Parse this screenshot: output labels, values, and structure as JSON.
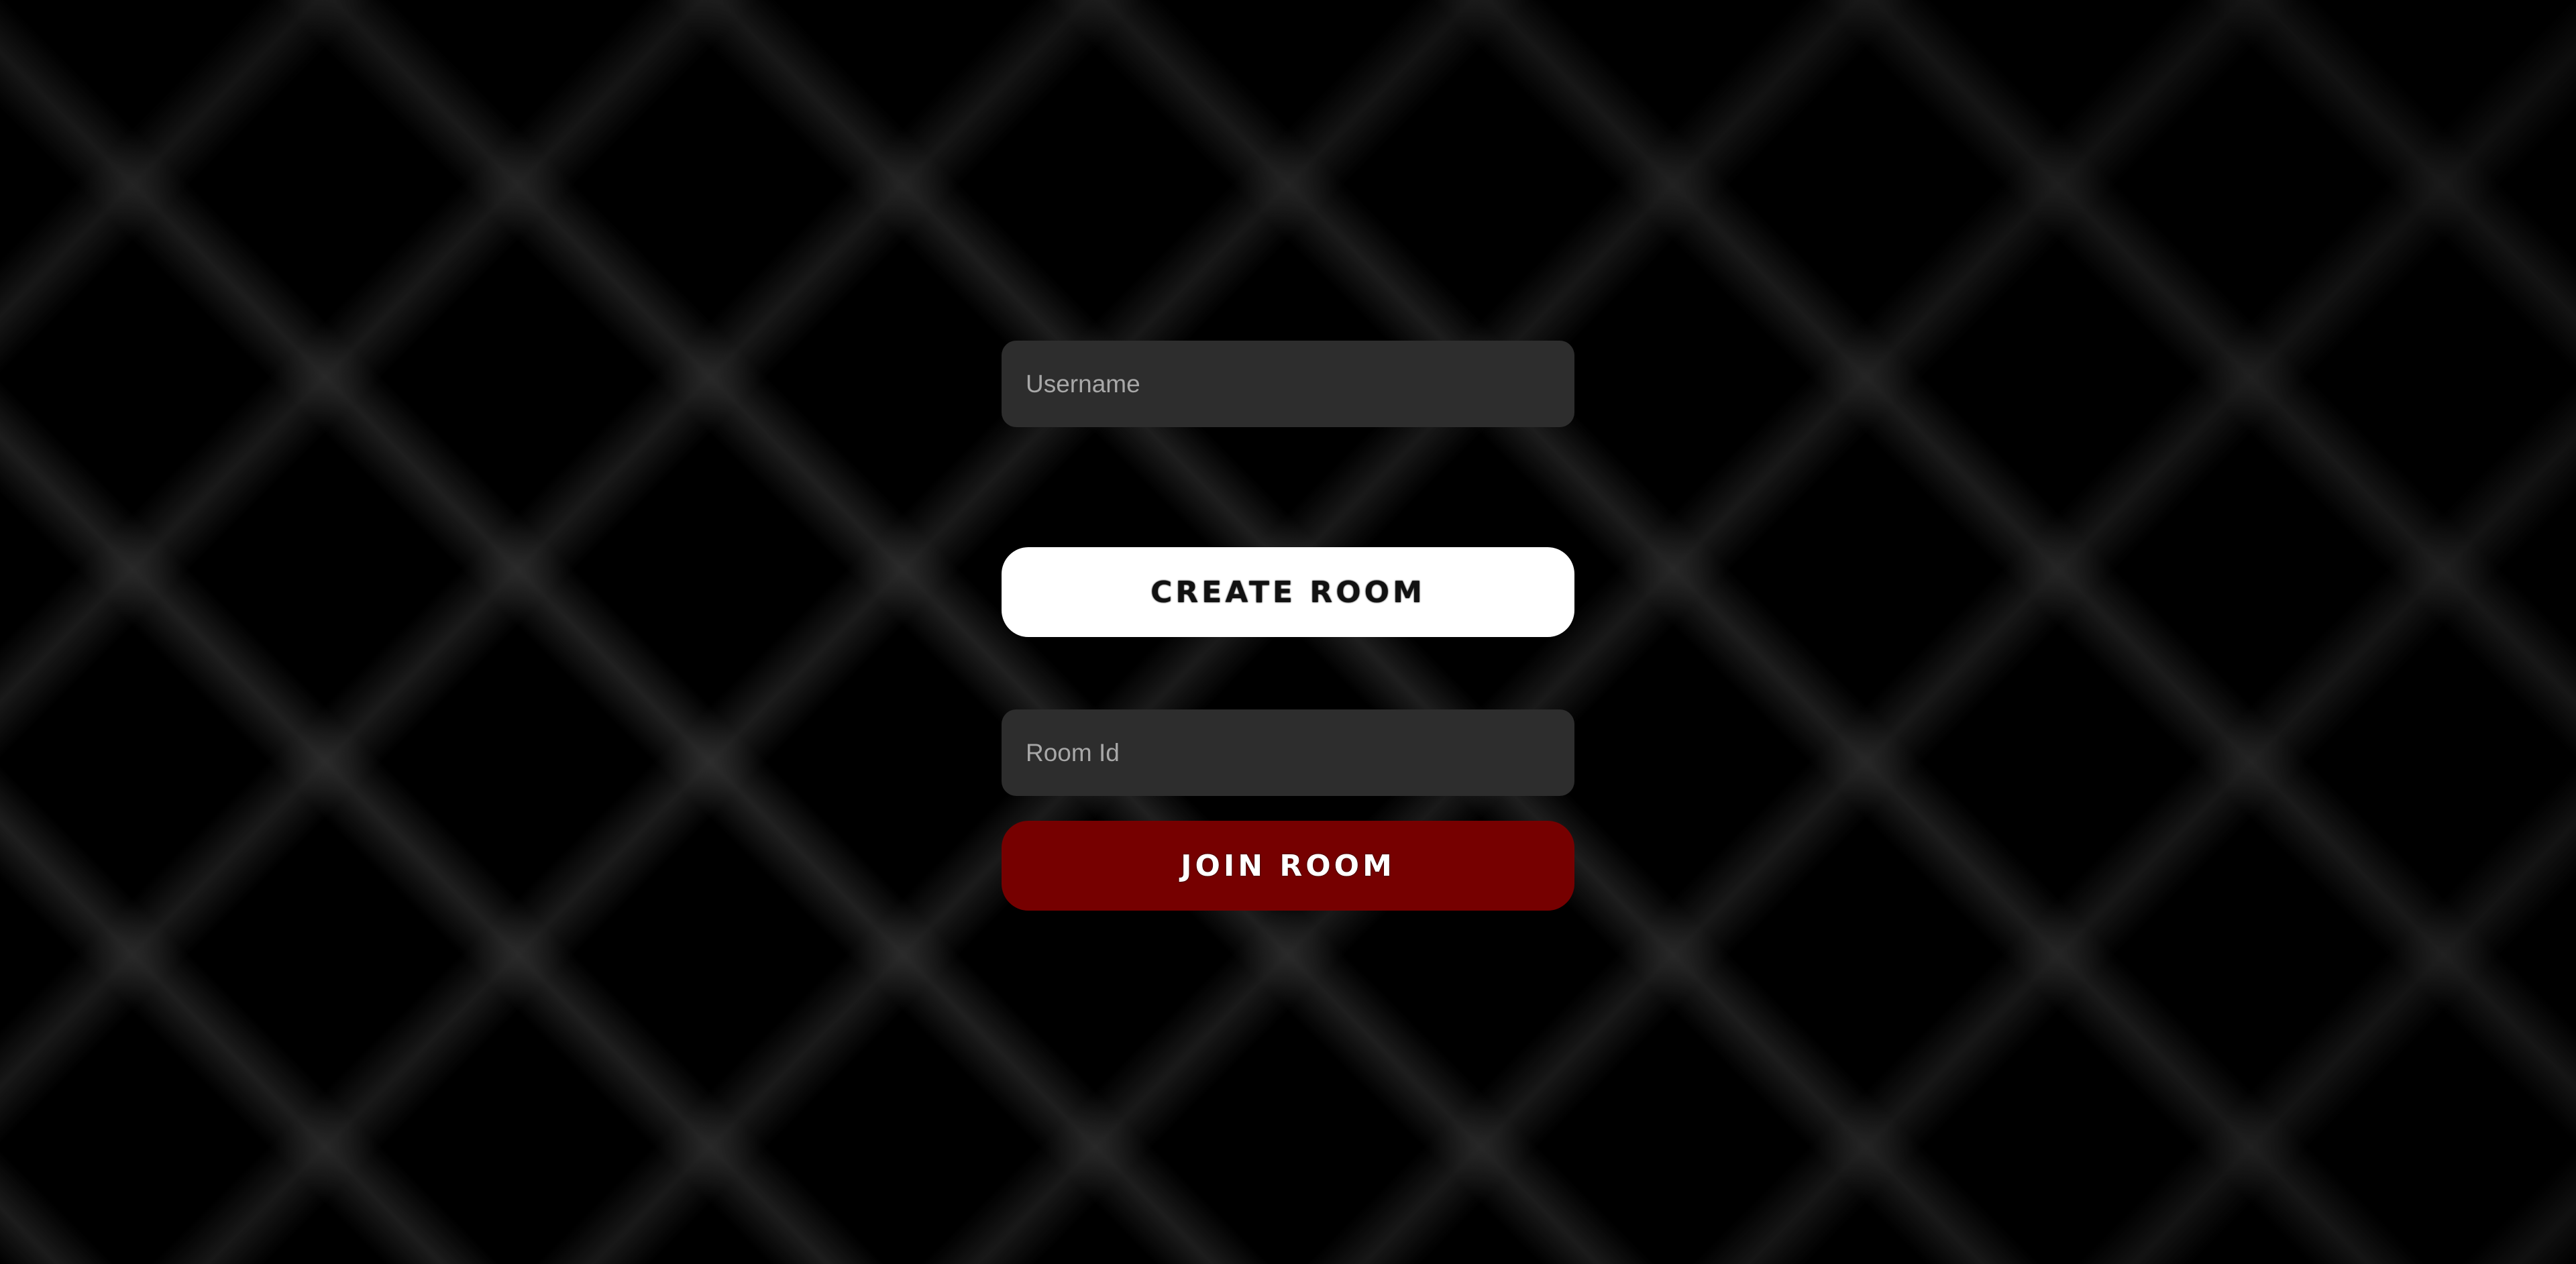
{
  "form": {
    "username": {
      "placeholder": "Username",
      "value": ""
    },
    "create_button": {
      "label": "CREATE ROOM"
    },
    "room_id": {
      "placeholder": "Room Id",
      "value": ""
    },
    "join_button": {
      "label": "JOIN ROOM"
    }
  },
  "colors": {
    "background": "#000000",
    "input_background": "#2d2d2d",
    "create_button": "#ffffff",
    "join_button": "#760000"
  }
}
